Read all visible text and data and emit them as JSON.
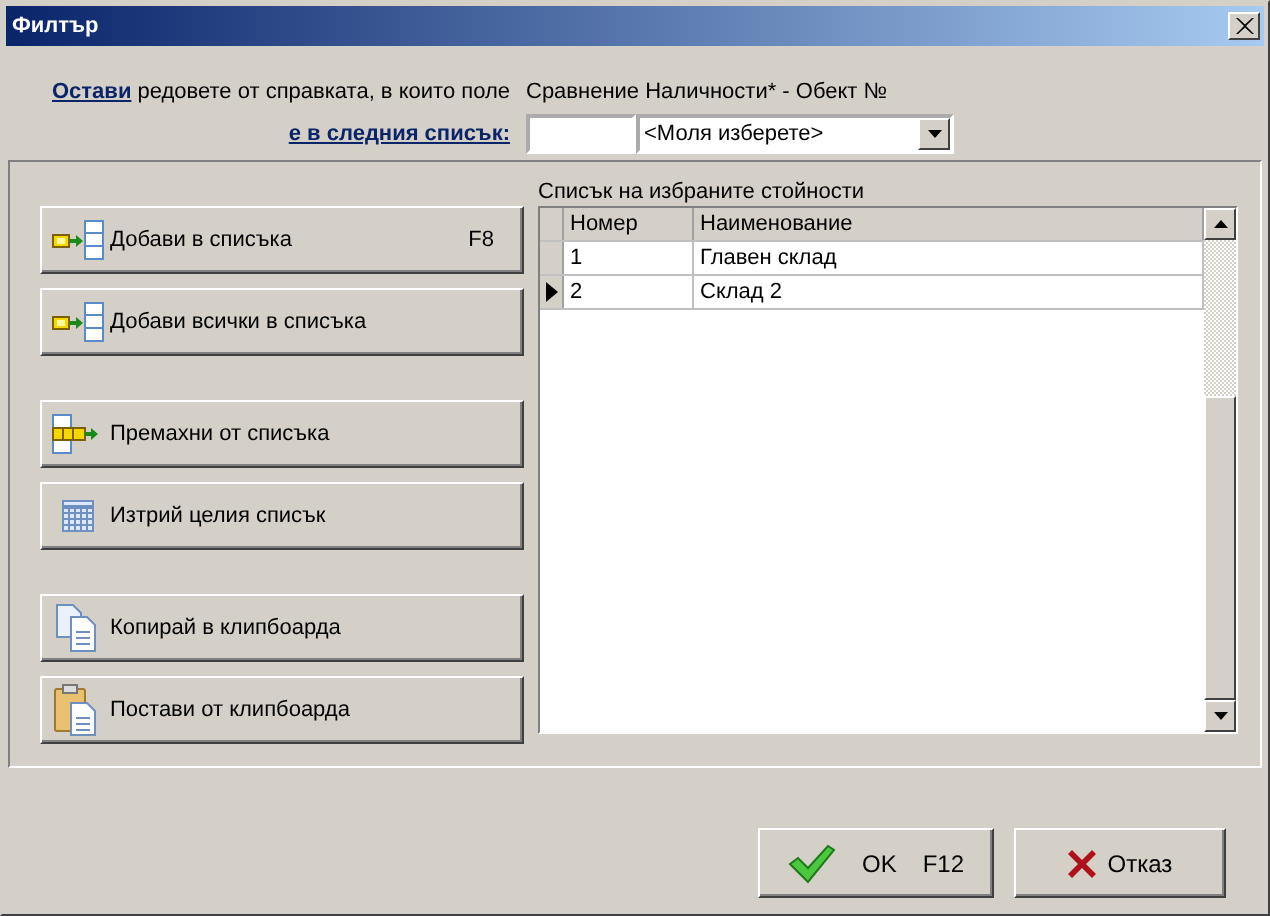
{
  "window": {
    "title": "Филтър"
  },
  "filter": {
    "link": "Остави",
    "text": "редовете от справката, в които поле",
    "field_name": "Сравнение Наличности* - Обект №",
    "condition": "е в следния списък:",
    "select_value": "<Моля изберете>"
  },
  "button_groups": [
    [
      {
        "label": "Добави в списъка",
        "shortcut": "F8"
      },
      {
        "label": "Добави всички в списъка"
      }
    ],
    [
      {
        "label": "Премахни от списъка"
      },
      {
        "label": "Изтрий целия списък"
      }
    ],
    [
      {
        "label": "Копирай в клипбоарда"
      },
      {
        "label": "Постави от клипбоарда"
      }
    ]
  ],
  "list": {
    "title": "Списък на избраните стойности",
    "columns": [
      "Номер",
      "Наименование"
    ],
    "rows": [
      {
        "cells": [
          "1",
          "Главен склад"
        ],
        "selected": false
      },
      {
        "cells": [
          "2",
          "Склад 2"
        ],
        "selected": true
      }
    ]
  },
  "footer": {
    "ok": {
      "label": "OK",
      "shortcut": "F12"
    },
    "cancel": {
      "label": "Отказ"
    }
  }
}
